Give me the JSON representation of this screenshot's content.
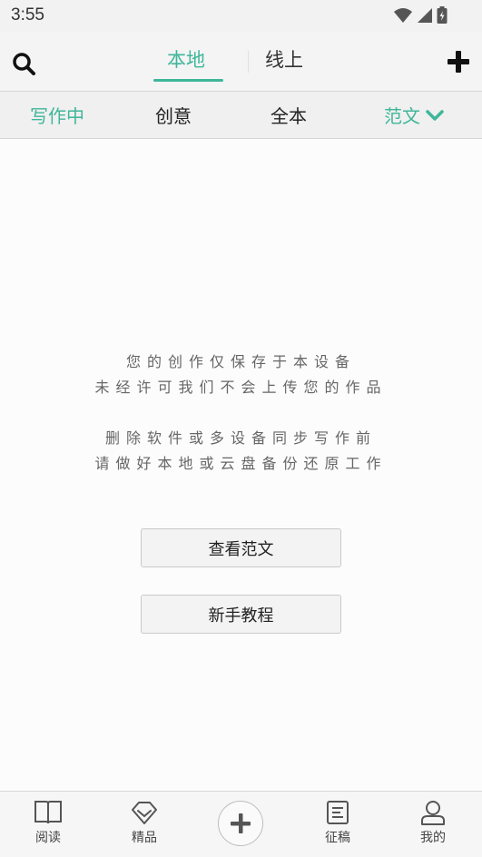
{
  "status_bar": {
    "time": "3:55"
  },
  "header": {
    "tabs": [
      {
        "label": "本地",
        "active": true
      },
      {
        "label": "线上",
        "active": false
      }
    ]
  },
  "subtabs": [
    {
      "label": "写作中",
      "active": true
    },
    {
      "label": "创意",
      "active": false
    },
    {
      "label": "全本",
      "active": false
    },
    {
      "label": "范文",
      "active": false,
      "dropdown": true
    }
  ],
  "notice": {
    "line1": "您的创作仅保存于本设备",
    "line2": "未经许可我们不会上传您的作品",
    "line3": "删除软件或多设备同步写作前",
    "line4": "请做好本地或云盘备份还原工作"
  },
  "buttons": {
    "view_samples": "查看范文",
    "beginner_tutorial": "新手教程"
  },
  "bottom_nav": {
    "read": "阅读",
    "premium": "精品",
    "contest": "征稿",
    "mine": "我的"
  },
  "colors": {
    "accent": "#3fb69a",
    "text": "#222222",
    "muted": "#666666"
  },
  "icons": {
    "search": "search-icon",
    "add": "plus-icon",
    "dropdown": "chevron-down-icon",
    "read": "book-icon",
    "premium": "diamond-icon",
    "center_add": "plus-circle-icon",
    "contest": "document-icon",
    "mine": "user-icon",
    "wifi": "wifi-icon",
    "signal": "signal-icon",
    "battery": "battery-icon"
  }
}
